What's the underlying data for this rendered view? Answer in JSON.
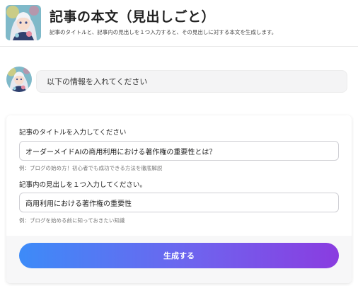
{
  "app": {
    "title": "記事の本文（見出しごと）",
    "description": "記事のタイトルと、記事内の見出しを１つ入力すると、その見出しに対する本文を生成します。",
    "avatar_icon": "anime-character-avatar-icon"
  },
  "chat": {
    "bot_avatar_icon": "anime-character-avatar-icon",
    "message": "以下の情報を入れてください"
  },
  "form": {
    "title_field": {
      "label": "記事のタイトルを入力してください",
      "value": "オーダーメイドAIの商用利用における著作権の重要性とは？",
      "hint": "例：ブログの始め方！初心者でも成功できる方法を徹底解説"
    },
    "heading_field": {
      "label": "記事内の見出しを１つ入力してください。",
      "value": "商用利用における著作権の重要性",
      "hint": "例：ブログを始める前に知っておきたい知識"
    },
    "submit_label": "生成する"
  },
  "colors": {
    "button_gradient_start": "#3d8bf8",
    "button_gradient_end": "#8a3ce0"
  }
}
